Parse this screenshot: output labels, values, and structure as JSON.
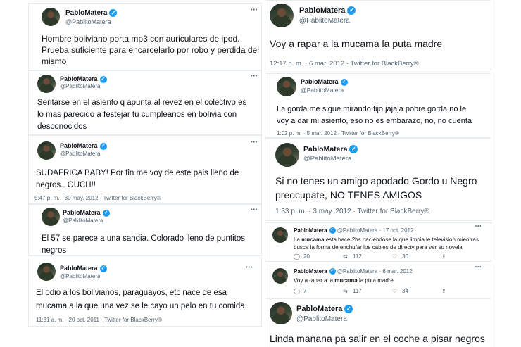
{
  "user": {
    "name": "PabloMatera",
    "handle": "@PablitoMatera"
  },
  "menu_glyph": "•••",
  "tweets": [
    {
      "text": "Hombre boliviano porta mp3 con auriculares de ipod.\nPrueba suficiente para encarcelarlo por robo y perdida del\nmismo"
    },
    {
      "text": "Sentarse en el asiento q apunta al revez en el colectivo es\nlo mas parecido a festejar tu cumpleanos en bolivia con\ndesconocidos"
    },
    {
      "text": "SUDAFRICA BABY! Por fin me voy de este pais lleno de\nnegros..   OUCH!!",
      "meta": "5:47 p. m. · 30 may. 2012 · Twitter for BlackBerry®"
    },
    {
      "text": "El 57 se parece a una sandia. Colorado lleno de puntitos\nnegros"
    },
    {
      "text": "El odio a los bolivianos, paraguayos, etc nace de esa\nmucama a la que una vez se le cayo un pelo en tu comida",
      "meta": "11:31 a. m. · 20 oct. 2011 · Twitter for BlackBerry®"
    },
    {
      "text": "Voy a rapar a la mucama la puta madre",
      "meta": "12:17 p. m. · 6 mar. 2012 · Twitter for BlackBerry®"
    },
    {
      "text": "La gorda me sigue mirando fijo jajaja pobre gorda no le\nvoy a dar mi asiento, eso no es embarazo, no, no cuenta",
      "meta": "1:02 p. m. · 5 mar. 2012 · Twitter for BlackBerry®"
    },
    {
      "text": "Si no tenes un amigo apodado Gordo u Negro\npreocupate, NO TENES AMIGOS",
      "meta": "1:33 p. m. · 3 may. 2012 · Twitter for BlackBerry®"
    },
    {
      "date": "· 17 oct. 2012",
      "text_before": "La ",
      "text_bold": "mucama",
      "text_after": " esta hace 2hs haciendose la que limpia le television mientras\nbusca la forma de enchufar los cables de directv para ver su novela",
      "replies": "20",
      "retweets": "112",
      "likes": "30"
    },
    {
      "date": "· 6 mar. 2012",
      "text_before": "Voy a rapar a la ",
      "text_bold": "mucama",
      "text_after": " la puta madre",
      "replies": "7",
      "retweets": "117",
      "likes": "34"
    },
    {
      "text": "Linda manana pa salir en el coche a pisar negros"
    }
  ]
}
